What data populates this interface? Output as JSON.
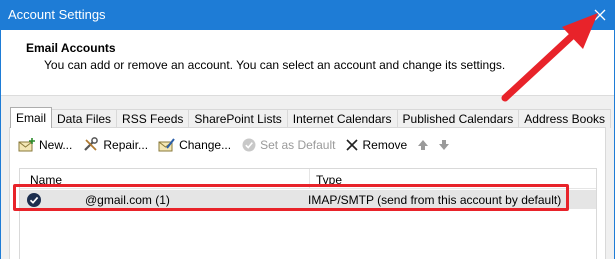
{
  "window": {
    "title": "Account Settings"
  },
  "header": {
    "title": "Email Accounts",
    "subtitle": "You can add or remove an account. You can select an account and change its settings."
  },
  "tabs": [
    {
      "label": "Email"
    },
    {
      "label": "Data Files"
    },
    {
      "label": "RSS Feeds"
    },
    {
      "label": "SharePoint Lists"
    },
    {
      "label": "Internet Calendars"
    },
    {
      "label": "Published Calendars"
    },
    {
      "label": "Address Books"
    }
  ],
  "toolbar": {
    "new_label": "New...",
    "repair_label": "Repair...",
    "change_label": "Change...",
    "set_default_label": "Set as Default",
    "remove_label": "Remove"
  },
  "list": {
    "columns": {
      "name": "Name",
      "type": "Type"
    },
    "rows": [
      {
        "name": "@gmail.com (1)",
        "type": "IMAP/SMTP (send from this account by default)"
      }
    ]
  },
  "colors": {
    "titlebar": "#1e7cd6",
    "annotation": "#e8232a"
  }
}
